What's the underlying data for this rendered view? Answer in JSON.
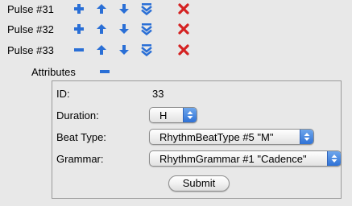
{
  "pulses": [
    {
      "label": "Pulse #31",
      "toggle": "plus-icon"
    },
    {
      "label": "Pulse #32",
      "toggle": "plus-icon"
    },
    {
      "label": "Pulse #33",
      "toggle": "minus-icon"
    }
  ],
  "icons": {
    "toggle_plus": "plus-icon",
    "toggle_minus": "minus-icon",
    "move_up": "arrow-up-icon",
    "move_down": "arrow-down-icon",
    "move_bottom": "double-chevron-down-icon",
    "delete": "red-x-delete-icon"
  },
  "colors": {
    "icon_blue": "#2a6fd6",
    "delete_red": "#d42222",
    "background": "#e8e8e8",
    "select_arrow_blue": "#3a7ee0"
  },
  "attributes": {
    "label": "Attributes",
    "toggle": "minus-icon",
    "id_label": "ID:",
    "id_value": "33",
    "duration_label": "Duration:",
    "duration_value": "H",
    "beat_type_label": "Beat Type:",
    "beat_type_value": "RhythmBeatType #5 \"M\"",
    "grammar_label": "Grammar:",
    "grammar_value": "RhythmGrammar #1 \"Cadence\"",
    "submit_label": "Submit"
  }
}
